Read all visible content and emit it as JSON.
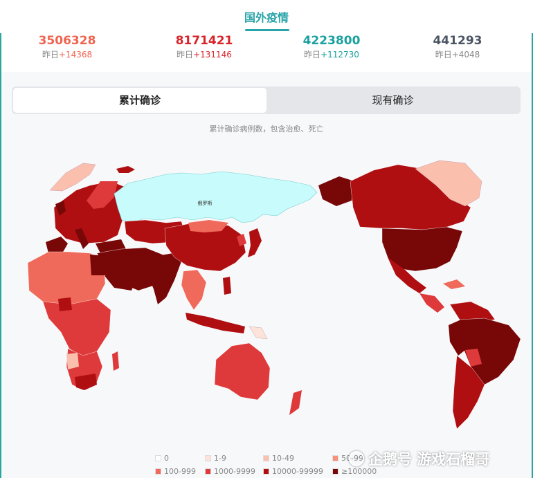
{
  "header": {
    "title": "国外疫情"
  },
  "stats": [
    {
      "value": "3506328",
      "delta_label": "昨日",
      "delta_value": "+14368",
      "color": "#f0634f"
    },
    {
      "value": "8171421",
      "delta_label": "昨日",
      "delta_value": "+131146",
      "color": "#d8232a"
    },
    {
      "value": "4223800",
      "delta_label": "昨日",
      "delta_value": "+112730",
      "color": "#1ba0a0"
    },
    {
      "value": "441293",
      "delta_label": "昨日",
      "delta_value": "+4048",
      "color": "#4b5563"
    }
  ],
  "tabs": {
    "active": "累计确诊",
    "inactive": "现有确诊"
  },
  "map": {
    "subtitle": "累计确诊病例数，包含治愈、死亡",
    "label_russia": "俄罗斯"
  },
  "legend": [
    {
      "label": "0",
      "color": "#ffffff"
    },
    {
      "label": "1-9",
      "color": "#fde3da"
    },
    {
      "label": "10-49",
      "color": "#fbbfad"
    },
    {
      "label": "50-99",
      "color": "#f7917a"
    },
    {
      "label": "100-999",
      "color": "#ef6a5a"
    },
    {
      "label": "1000-9999",
      "color": "#de3a3b"
    },
    {
      "label": "10000-99999",
      "color": "#b00f12"
    },
    {
      "label": "≥100000",
      "color": "#780708"
    }
  ],
  "watermark": "企鹅号 游戏石榴哥"
}
